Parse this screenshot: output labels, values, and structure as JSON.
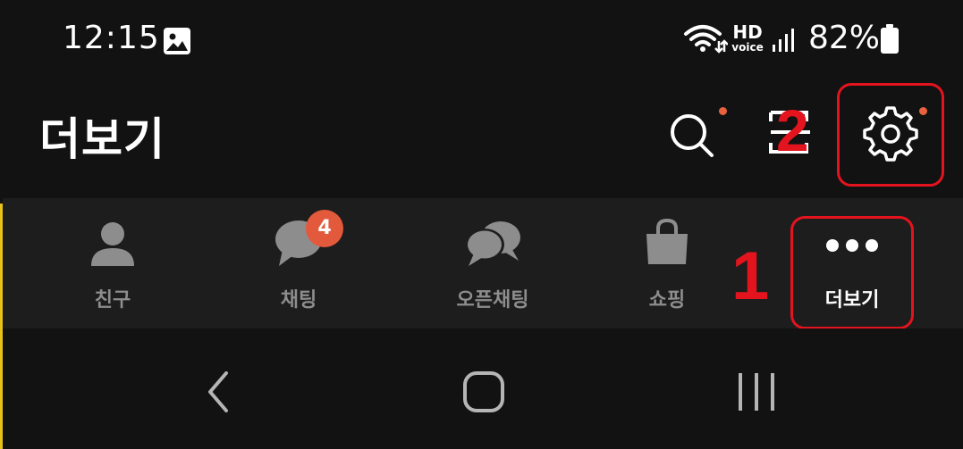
{
  "status_bar": {
    "time": "12:15",
    "gallery_icon": "gallery-icon",
    "wifi_icon": "wifi-icon",
    "hd_label": "HD",
    "voice_label": "voice",
    "signal_icon": "signal-icon",
    "battery_percent": "82%",
    "battery_icon": "battery-icon"
  },
  "header": {
    "title": "더보기",
    "search_icon": "search-icon",
    "scan_icon": "scan-icon",
    "settings_icon": "gear-icon",
    "notification_dot_color": "#e9623e"
  },
  "annotations": [
    {
      "number": "1",
      "target": "nav-more"
    },
    {
      "number": "2",
      "target": "settings-button"
    }
  ],
  "annotation_color": "#e3141e",
  "bottom_nav": {
    "items": [
      {
        "label": "친구",
        "icon": "person-icon",
        "active": false
      },
      {
        "label": "채팅",
        "icon": "chat-bubble-icon",
        "active": false,
        "badge": "4"
      },
      {
        "label": "오픈채팅",
        "icon": "open-chat-icon",
        "active": false
      },
      {
        "label": "쇼핑",
        "icon": "shopping-bag-icon",
        "active": false
      },
      {
        "label": "더보기",
        "icon": "more-dots-icon",
        "active": true
      }
    ],
    "badge_color": "#e3593b"
  },
  "system_nav": {
    "back_icon": "back-icon",
    "home_icon": "home-icon",
    "recents_icon": "recents-icon"
  }
}
